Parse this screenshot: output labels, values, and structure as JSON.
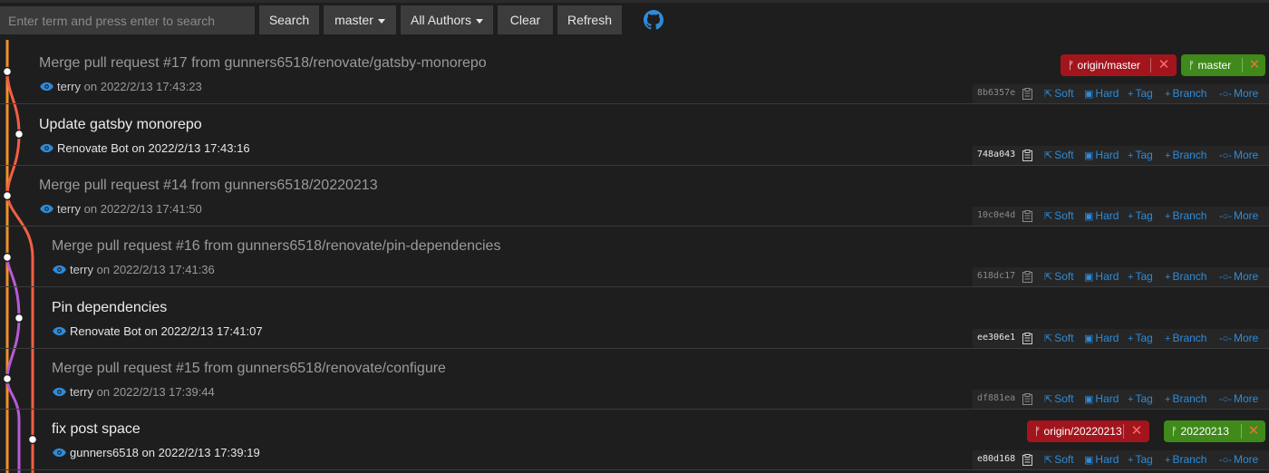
{
  "toolbar": {
    "search_placeholder": "Enter term and press enter to search",
    "search_label": "Search",
    "branch_label": "master",
    "authors_label": "All Authors",
    "clear_label": "Clear",
    "refresh_label": "Refresh"
  },
  "actions": {
    "soft": "Soft",
    "hard": "Hard",
    "tag": "Tag",
    "branch": "Branch",
    "more": "More"
  },
  "commits": [
    {
      "message": "Merge pull request #17 from gunners6518/renovate/gatsby-monorepo",
      "author": "terry",
      "on": "on",
      "date": "2022/2/13 17:43:23",
      "hash": "8b6357e"
    },
    {
      "message": "Update gatsby monorepo",
      "author": "Renovate Bot",
      "on": "on",
      "date": "2022/2/13 17:43:16",
      "hash": "748a043"
    },
    {
      "message": "Merge pull request #14 from gunners6518/20220213",
      "author": "terry",
      "on": "on",
      "date": "2022/2/13 17:41:50",
      "hash": "10c0e4d"
    },
    {
      "message": "Merge pull request #16 from gunners6518/renovate/pin-dependencies",
      "author": "terry",
      "on": "on",
      "date": "2022/2/13 17:41:36",
      "hash": "618dc17"
    },
    {
      "message": "Pin dependencies",
      "author": "Renovate Bot",
      "on": "on",
      "date": "2022/2/13 17:41:07",
      "hash": "ee306e1"
    },
    {
      "message": "Merge pull request #15 from gunners6518/renovate/configure",
      "author": "terry",
      "on": "on",
      "date": "2022/2/13 17:39:44",
      "hash": "df881ea"
    },
    {
      "message": "fix post space",
      "author": "gunners6518",
      "on": "on",
      "date": "2022/2/13 17:39:19",
      "hash": "e80d168"
    }
  ],
  "refs": {
    "row0_remote": "origin/master",
    "row0_local": "master",
    "row6_remote": "origin/20220213",
    "row6_local": "20220213",
    "close_glyph": "✕"
  },
  "colors": {
    "graph_orange": "#f0902a",
    "graph_red": "#f25f44",
    "graph_purple": "#b65ad6",
    "link_blue": "#2f8bd8",
    "remote_ref_red": "#a3151d",
    "local_ref_green": "#3f8a1a"
  },
  "icons": {
    "github": "github-icon",
    "eye": "eye-icon",
    "copy": "copy-icon",
    "branch": "branch-icon"
  }
}
